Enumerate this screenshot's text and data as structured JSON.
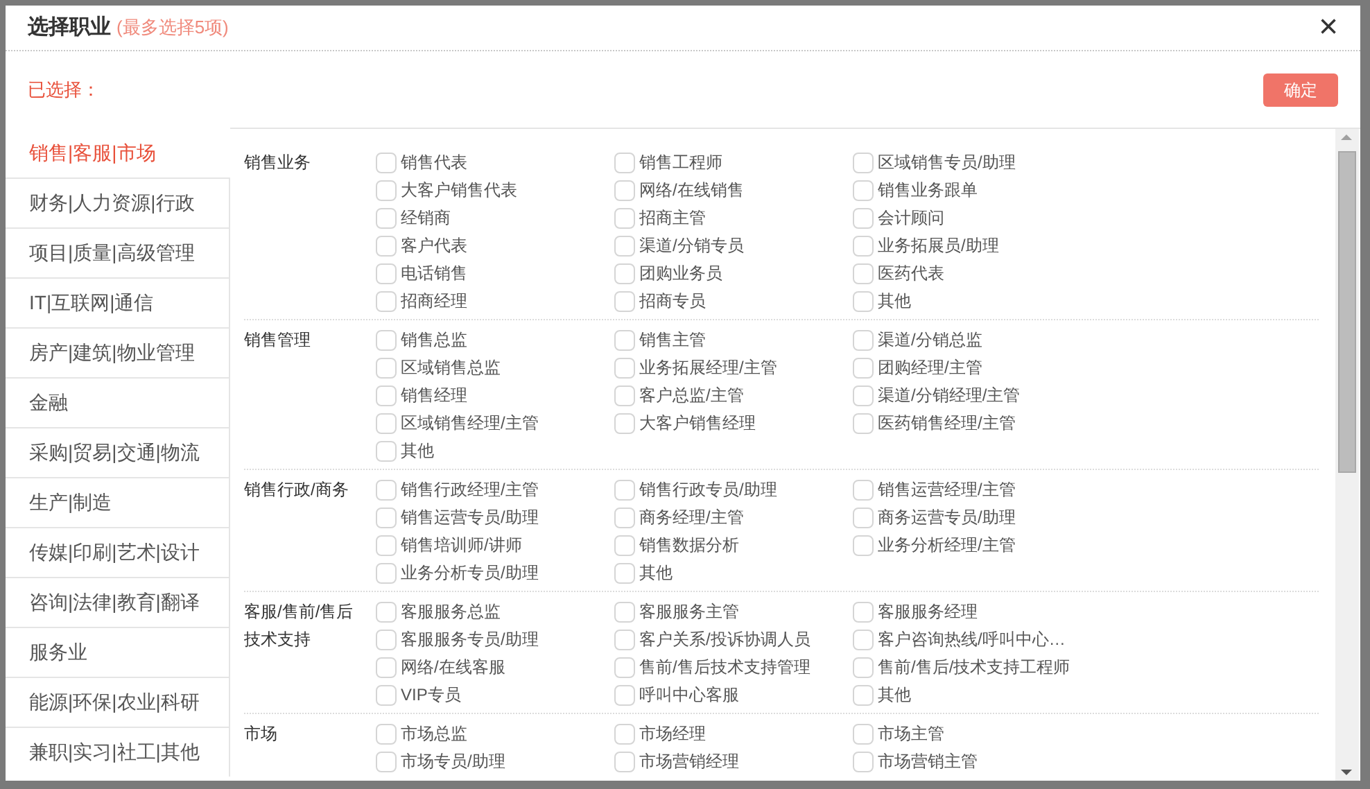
{
  "dialog": {
    "title": "选择职业",
    "hint": "(最多选择5项)",
    "close": "×"
  },
  "selected_label": "已选择：",
  "confirm_button": "确定",
  "sidebar": {
    "items": [
      {
        "label": "销售|客服|市场",
        "selected": true
      },
      {
        "label": "财务|人力资源|行政",
        "selected": false
      },
      {
        "label": "项目|质量|高级管理",
        "selected": false
      },
      {
        "label": "IT|互联网|通信",
        "selected": false
      },
      {
        "label": "房产|建筑|物业管理",
        "selected": false
      },
      {
        "label": "金融",
        "selected": false
      },
      {
        "label": "采购|贸易|交通|物流",
        "selected": false
      },
      {
        "label": "生产|制造",
        "selected": false
      },
      {
        "label": "传媒|印刷|艺术|设计",
        "selected": false
      },
      {
        "label": "咨询|法律|教育|翻译",
        "selected": false
      },
      {
        "label": "服务业",
        "selected": false
      },
      {
        "label": "能源|环保|农业|科研",
        "selected": false
      },
      {
        "label": "兼职|实习|社工|其他",
        "selected": false
      }
    ]
  },
  "groups": [
    {
      "title": "销售业务",
      "items": [
        {
          "label": "销售代表",
          "checked": false
        },
        {
          "label": "销售工程师",
          "checked": false
        },
        {
          "label": "区域销售专员/助理",
          "checked": false
        },
        {
          "label": "大客户销售代表",
          "checked": false
        },
        {
          "label": "网络/在线销售",
          "checked": false
        },
        {
          "label": "销售业务跟单",
          "checked": false
        },
        {
          "label": "经销商",
          "checked": false
        },
        {
          "label": "招商主管",
          "checked": false
        },
        {
          "label": "会计顾问",
          "checked": false
        },
        {
          "label": "客户代表",
          "checked": false
        },
        {
          "label": "渠道/分销专员",
          "checked": false
        },
        {
          "label": "业务拓展员/助理",
          "checked": false
        },
        {
          "label": "电话销售",
          "checked": false
        },
        {
          "label": "团购业务员",
          "checked": false
        },
        {
          "label": "医药代表",
          "checked": false
        },
        {
          "label": "招商经理",
          "checked": false
        },
        {
          "label": "招商专员",
          "checked": false
        },
        {
          "label": "其他",
          "checked": false
        }
      ]
    },
    {
      "title": "销售管理",
      "items": [
        {
          "label": "销售总监",
          "checked": false
        },
        {
          "label": "销售主管",
          "checked": false
        },
        {
          "label": "渠道/分销总监",
          "checked": false
        },
        {
          "label": "区域销售总监",
          "checked": false
        },
        {
          "label": "业务拓展经理/主管",
          "checked": false
        },
        {
          "label": "团购经理/主管",
          "checked": false
        },
        {
          "label": "销售经理",
          "checked": false
        },
        {
          "label": "客户总监/主管",
          "checked": false
        },
        {
          "label": "渠道/分销经理/主管",
          "checked": false
        },
        {
          "label": "区域销售经理/主管",
          "checked": false
        },
        {
          "label": "大客户销售经理",
          "checked": false
        },
        {
          "label": "医药销售经理/主管",
          "checked": false
        },
        {
          "label": "其他",
          "checked": false
        }
      ]
    },
    {
      "title": "销售行政/商务",
      "items": [
        {
          "label": "销售行政经理/主管",
          "checked": false
        },
        {
          "label": "销售行政专员/助理",
          "checked": false
        },
        {
          "label": "销售运营经理/主管",
          "checked": false
        },
        {
          "label": "销售运营专员/助理",
          "checked": false
        },
        {
          "label": "商务经理/主管",
          "checked": false
        },
        {
          "label": "商务运营专员/助理",
          "checked": false
        },
        {
          "label": "销售培训师/讲师",
          "checked": false
        },
        {
          "label": "销售数据分析",
          "checked": false
        },
        {
          "label": "业务分析经理/主管",
          "checked": false
        },
        {
          "label": "业务分析专员/助理",
          "checked": false
        },
        {
          "label": "其他",
          "checked": false
        }
      ]
    },
    {
      "title": "客服/售前/售后技术支持",
      "items": [
        {
          "label": "客服服务总监",
          "checked": false
        },
        {
          "label": "客服服务主管",
          "checked": false
        },
        {
          "label": "客服服务经理",
          "checked": false
        },
        {
          "label": "客服服务专员/助理",
          "checked": false
        },
        {
          "label": "客户关系/投诉协调人员",
          "checked": false
        },
        {
          "label": "客户咨询热线/呼叫中心…",
          "checked": false
        },
        {
          "label": "网络/在线客服",
          "checked": false
        },
        {
          "label": "售前/售后技术支持管理",
          "checked": false
        },
        {
          "label": "售前/售后/技术支持工程师",
          "checked": false
        },
        {
          "label": "VIP专员",
          "checked": false
        },
        {
          "label": "呼叫中心客服",
          "checked": false
        },
        {
          "label": "其他",
          "checked": false
        }
      ]
    },
    {
      "title": "市场",
      "items": [
        {
          "label": "市场总监",
          "checked": false
        },
        {
          "label": "市场经理",
          "checked": false
        },
        {
          "label": "市场主管",
          "checked": false
        },
        {
          "label": "市场专员/助理",
          "checked": false
        },
        {
          "label": "市场营销经理",
          "checked": false
        },
        {
          "label": "市场营销主管",
          "checked": false
        }
      ]
    }
  ]
}
